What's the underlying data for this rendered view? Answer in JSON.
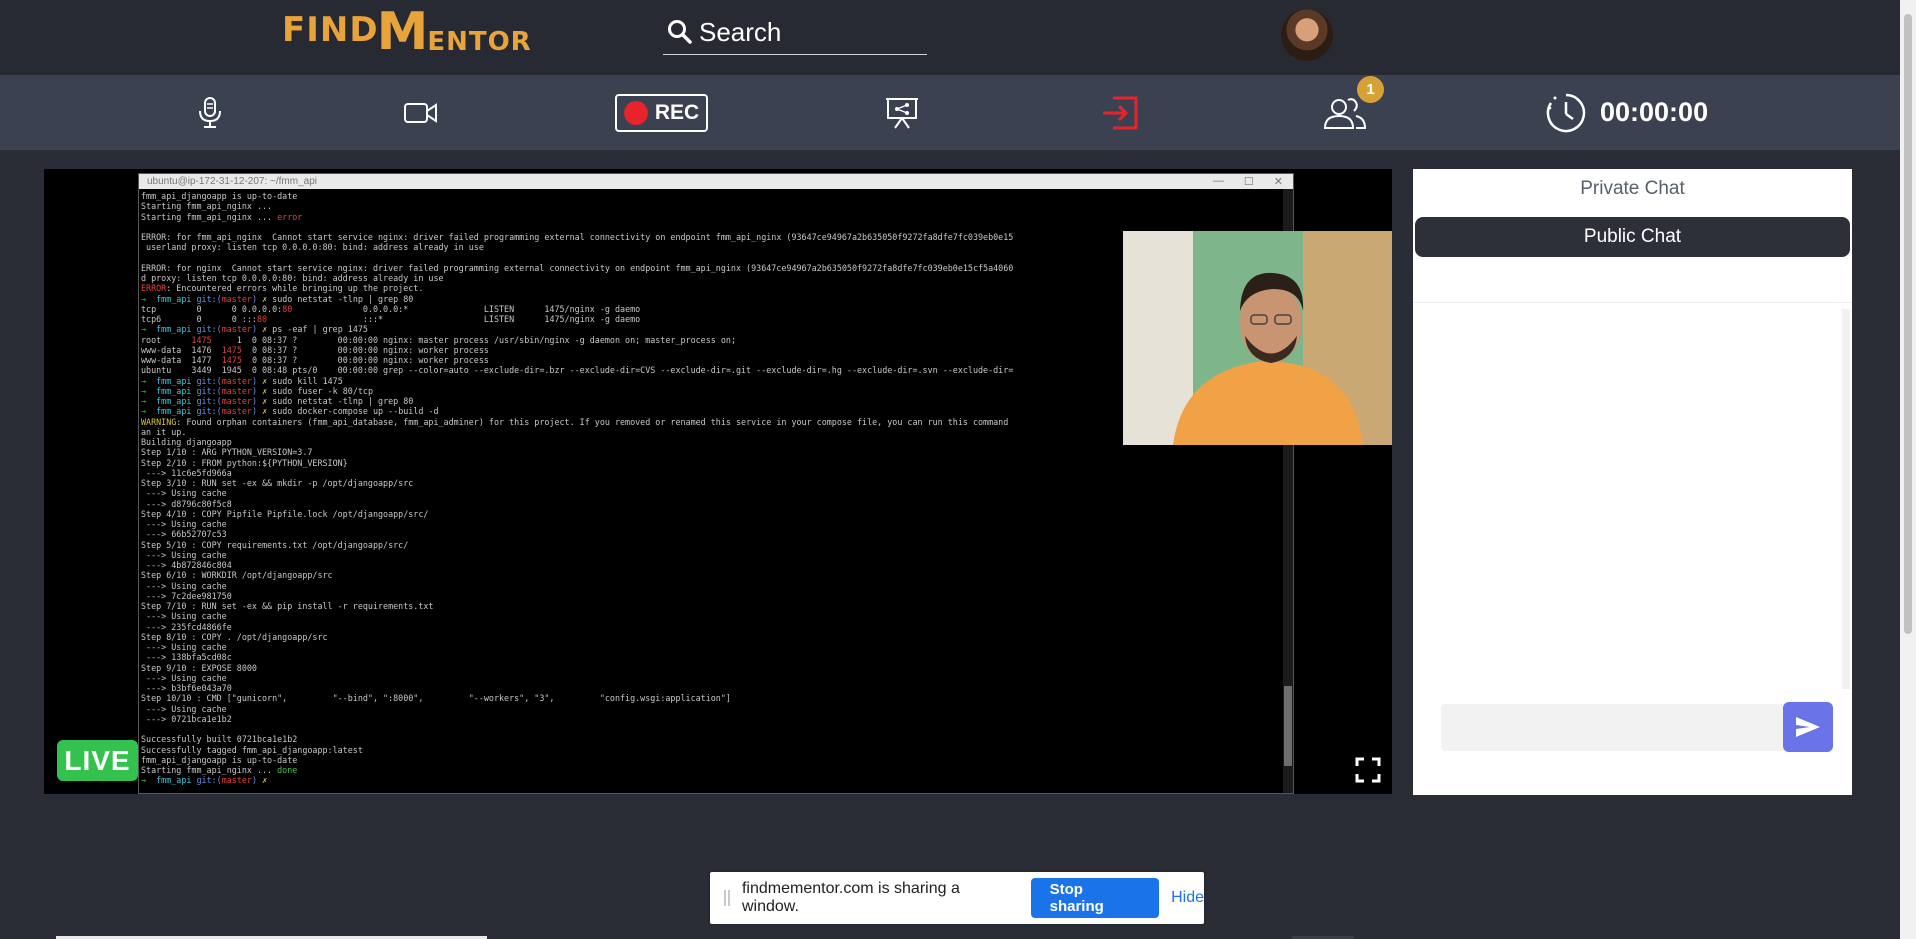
{
  "header": {
    "logo_text": "FINDMENTOR",
    "search_placeholder": "Search"
  },
  "toolbar": {
    "rec_label": "REC",
    "participants_count": "1",
    "timer": "00:00:00"
  },
  "terminal": {
    "window_title": "ubuntu@ip-172-31-12-207: ~/fmm_api"
  },
  "stage": {
    "live_label": "LIVE"
  },
  "chat": {
    "private_tab": "Private Chat",
    "public_tab": "Public Chat",
    "input_value": ""
  },
  "share_bar": {
    "message": "findmementor.com is sharing a window.",
    "stop_label": "Stop sharing",
    "hide_label": "Hide"
  },
  "colors": {
    "accent": "#e8a33b",
    "rec_red": "#e8232b",
    "live_green": "#33c24d",
    "send_purple": "#6a74e8",
    "share_blue": "#1a73e8"
  }
}
